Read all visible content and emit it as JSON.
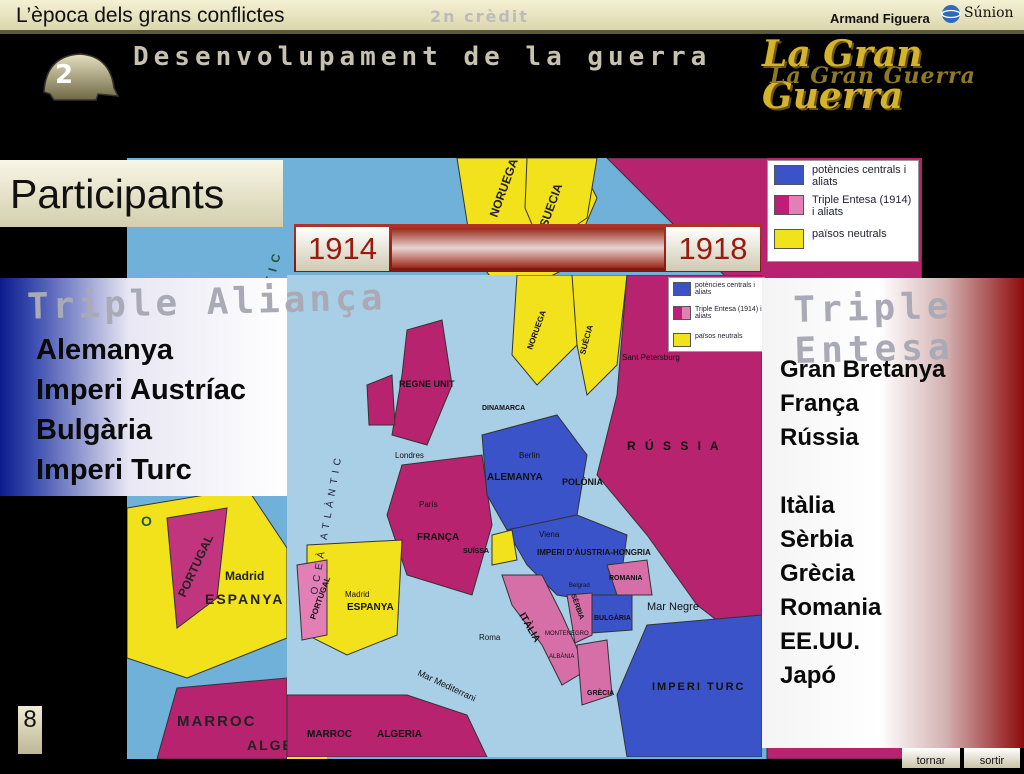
{
  "header": {
    "course_title": "L’època dels grans conflictes",
    "credit": "2n crèdit",
    "author": "Armand Figuera",
    "brand": "Súnion"
  },
  "unit": {
    "number": "2",
    "section_title": "Desenvolupament de la guerra",
    "logo_text": "La Gran Guerra"
  },
  "slide": {
    "title": "Participants",
    "year_start": "1914",
    "year_end": "1918",
    "page": "8"
  },
  "legend": [
    {
      "label": "potències centrals i aliats",
      "color": "#3a53c9"
    },
    {
      "label": "Triple Entesa (1914) i aliats",
      "color": "#c01c78"
    },
    {
      "label": "països neutrals",
      "color": "#f2e21b"
    }
  ],
  "triple_alianca": {
    "title": "Triple Aliança",
    "members": [
      "Alemanya",
      "Imperi Austríac",
      "Bulgària",
      "Imperi Turc"
    ]
  },
  "triple_entesa": {
    "title": "Triple Entesa",
    "members_1914": [
      "Gran Bretanya",
      "França",
      "Rússia"
    ],
    "members_later": [
      "Itàlia",
      "Sèrbia",
      "Grècia",
      "Romania",
      "EE.UU.",
      "Japó"
    ]
  },
  "big_map_labels": [
    "NORUEGA",
    "SUECIA",
    "Madrid",
    "ESPANYA",
    "PORTUGAL",
    "MARROC",
    "ALGERIA",
    "OCEÀ ATLÀNTIC",
    "O"
  ],
  "small_map_labels": {
    "regne_unit": "REGNE UNIT",
    "london": "Londres",
    "paris": "París",
    "franca": "FRANÇA",
    "alemanya": "ALEMANYA",
    "berlin": "Berlín",
    "imperi_austria": "IMPERI D’ÀUSTRIA-HONGRIA",
    "viena": "Viena",
    "russia": "R Ú S S I A",
    "st_petersburg": "Sant Petersburg",
    "polonia": "POLÒNIA",
    "suissa": "SUÏSSA",
    "italia": "ITÀLIA",
    "roma": "Roma",
    "espanya": "ESPANYA",
    "madrid": "Madrid",
    "portugal": "PORTUGAL",
    "marroc": "MARROC",
    "algeria": "ALGERIA",
    "mar_negre": "Mar Negre",
    "imperi_turc": "IMPERI TURC",
    "mar_mediterrani": "Mar Mediterrani",
    "grecia": "GRÈCIA",
    "bulgaria": "BULGÀRIA",
    "romania": "ROMANIA",
    "serbia": "SÈRBIA",
    "montenegro": "MONTENEGRO",
    "albania": "ALBÀNIA",
    "belgrad": "Belgrad",
    "dinamarca": "DINAMARCA",
    "noruega": "NORUEGA",
    "suecia": "SUÈCIA",
    "ocea": "OCEÀ ATLÀNTIC"
  },
  "nav": {
    "back": "tornar",
    "exit": "sortir"
  }
}
